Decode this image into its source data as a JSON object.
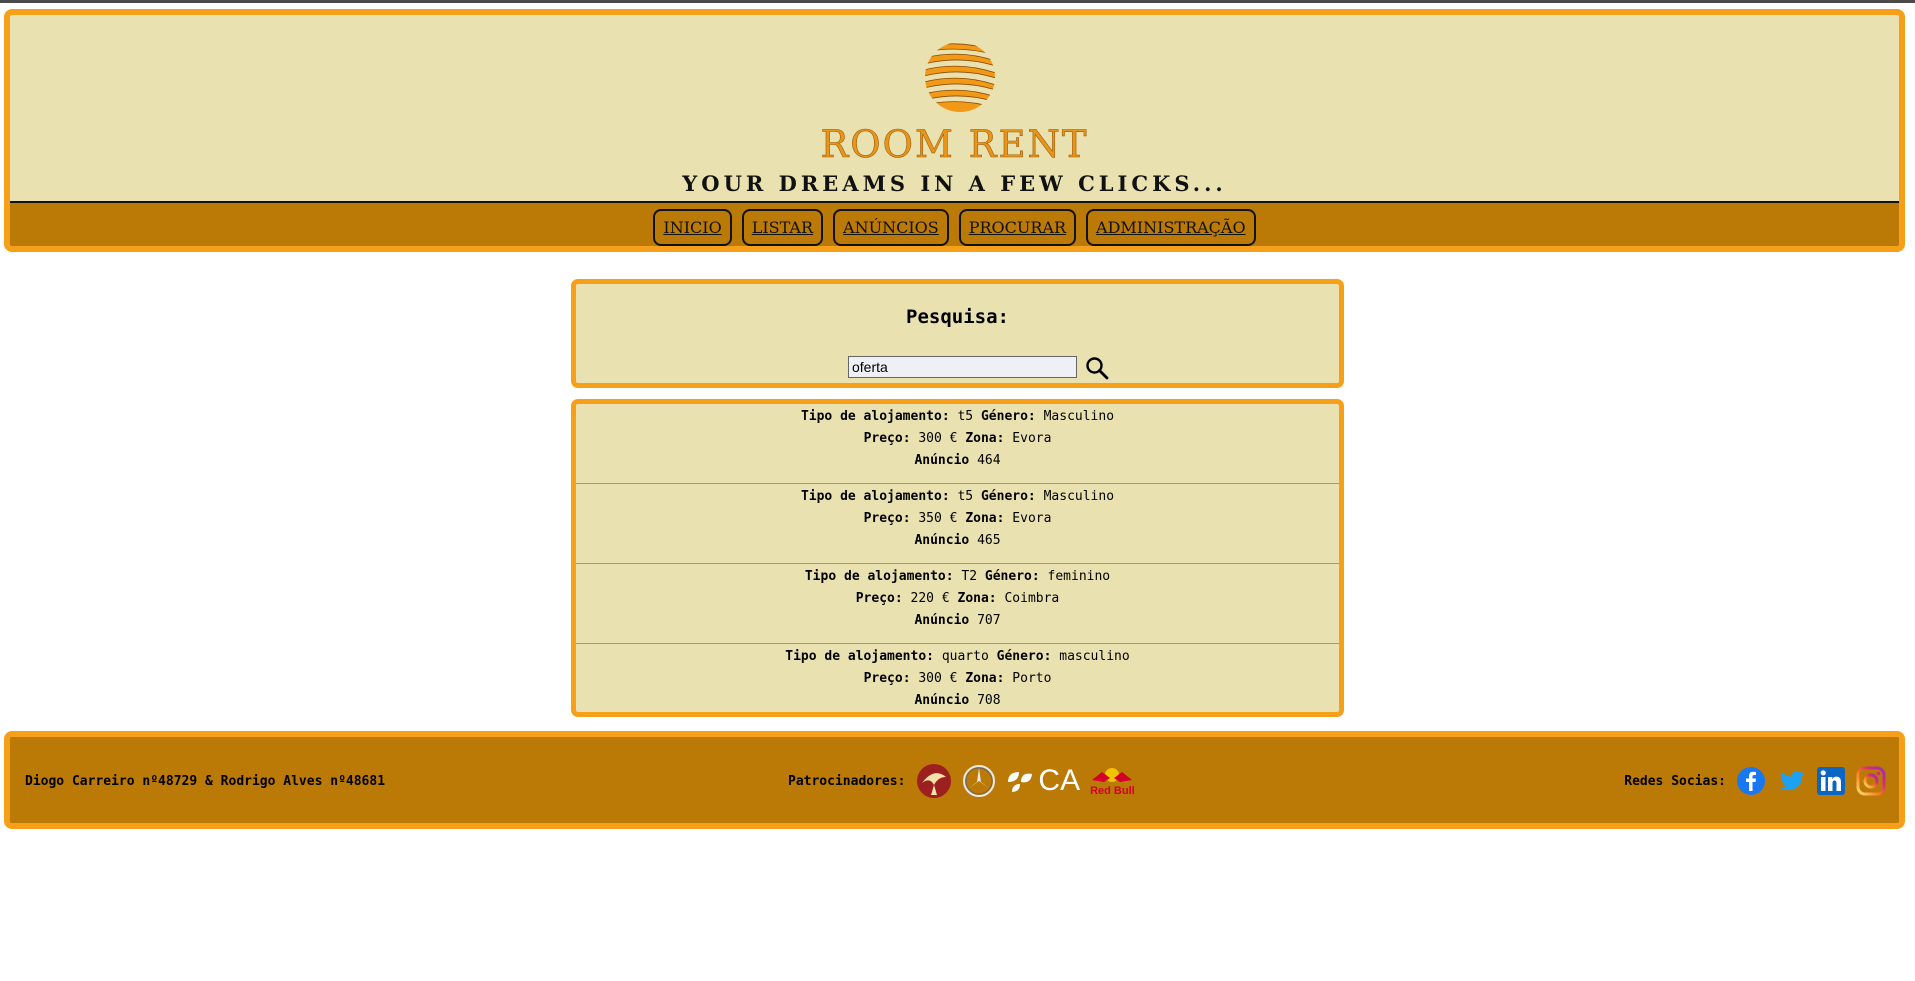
{
  "header": {
    "brand": "ROOM RENT",
    "tagline": "YOUR DREAMS IN A FEW CLICKS...",
    "logo_icon": "sun-stripes-icon"
  },
  "nav": {
    "items": [
      {
        "label": "INICIO"
      },
      {
        "label": "LISTAR"
      },
      {
        "label": "ANÚNCIOS"
      },
      {
        "label": "PROCURAR"
      },
      {
        "label": "ADMINISTRAÇÃO"
      }
    ]
  },
  "search": {
    "title": "Pesquisa:",
    "value": "oferta",
    "icon": "magnifier-icon"
  },
  "labels": {
    "tipo": "Tipo de alojamento:",
    "genero": "Género:",
    "preco": "Preço:",
    "zona": "Zona:",
    "anuncio": "Anúncio"
  },
  "results": [
    {
      "tipo": "t5",
      "genero": "Masculino",
      "preco": "300 €",
      "zona": "Evora",
      "anuncio": "464"
    },
    {
      "tipo": "t5",
      "genero": "Masculino",
      "preco": "350 €",
      "zona": "Evora",
      "anuncio": "465"
    },
    {
      "tipo": "T2",
      "genero": "feminino",
      "preco": "220 €",
      "zona": "Coimbra",
      "anuncio": "707"
    },
    {
      "tipo": "quarto",
      "genero": "masculino",
      "preco": "300 €",
      "zona": "Porto",
      "anuncio": "708"
    }
  ],
  "footer": {
    "authors": "Diogo Carreiro nº48729 & Rodrigo Alves nº48681",
    "sponsors_label": "Patrocinadores:",
    "sponsor_ca_text": "CA",
    "sponsor_redbull_text": "Red Bull",
    "social_label": "Redes Socias:"
  },
  "colors": {
    "accent_orange": "#f6a01a",
    "panel_bg": "#e9e2b0",
    "nav_bg": "#bb7906"
  }
}
